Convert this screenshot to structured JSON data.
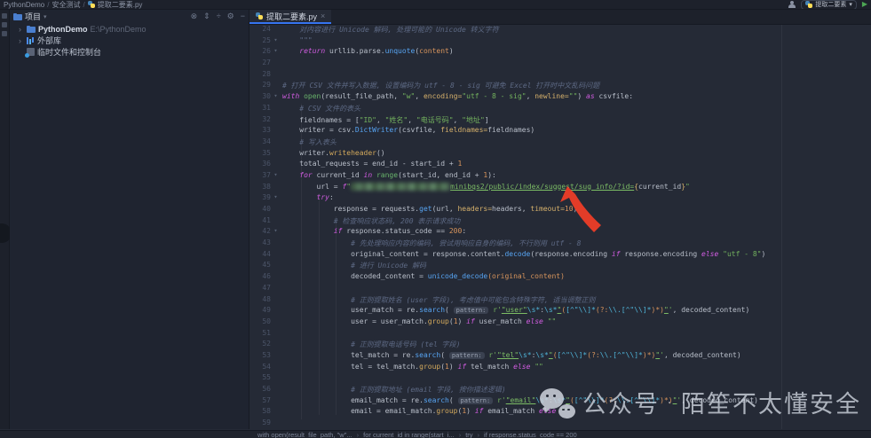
{
  "window": {
    "breadcrumb": [
      "PythonDemo",
      "安全测试",
      "提取二要素.py"
    ],
    "breadcrumb_separator": "/",
    "run_config": "提取二要素",
    "run_caret": "▾",
    "play_glyph": "▶"
  },
  "project_panel": {
    "title": "项目",
    "title_caret": "▾",
    "toolbar_icons": [
      {
        "name": "locate-file-icon",
        "glyph": "⊗"
      },
      {
        "name": "collapse-all-icon",
        "glyph": "⇕"
      },
      {
        "name": "split-view-icon",
        "glyph": "÷"
      },
      {
        "name": "settings-gear-icon",
        "glyph": "⚙"
      },
      {
        "name": "hide-panel-icon",
        "glyph": "−"
      }
    ],
    "tree": [
      {
        "label": "PythonDemo",
        "detail": "E:\\PythonDemo",
        "icon": "folder",
        "chevron": "›"
      },
      {
        "label": "外部库",
        "detail": "",
        "icon": "library",
        "chevron": "›"
      },
      {
        "label": "临时文件和控制台",
        "detail": "",
        "icon": "scratch",
        "chevron": ""
      }
    ]
  },
  "editor": {
    "tab": {
      "title": "提取二要素.py",
      "close_glyph": "×"
    },
    "fold_glyph": "▾",
    "lines": [
      {
        "n": 24,
        "t": [
          [
            "d",
            "    对内容进行 Unicode 解码, 处理可能的 Unicode 转义字符"
          ]
        ]
      },
      {
        "n": 25,
        "fold": true,
        "t": [
          [
            "d",
            "    \"\"\""
          ]
        ]
      },
      {
        "n": 26,
        "fold": true,
        "t": [
          [
            "t",
            "    "
          ],
          [
            "k",
            "return"
          ],
          [
            "t",
            " urllib.parse."
          ],
          [
            "f",
            "unquote"
          ],
          [
            "t",
            "("
          ],
          [
            "p",
            "content"
          ],
          [
            "t",
            ")"
          ]
        ]
      },
      {
        "n": 27,
        "t": []
      },
      {
        "n": 28,
        "t": []
      },
      {
        "n": 29,
        "t": [
          [
            "c",
            "# 打开 CSV 文件并写入数据, 设置编码为 utf - 8 - sig 可避免 Excel 打开时中文乱码问题"
          ]
        ]
      },
      {
        "n": 30,
        "fold": true,
        "t": [
          [
            "k",
            "with"
          ],
          [
            "t",
            " "
          ],
          [
            "b",
            "open"
          ],
          [
            "t",
            "(result_file_path, "
          ],
          [
            "s",
            "\"w\""
          ],
          [
            "t",
            ", "
          ],
          [
            "a",
            "encoding="
          ],
          [
            "s",
            "\"utf - 8 - sig\""
          ],
          [
            "t",
            ", "
          ],
          [
            "a",
            "newline="
          ],
          [
            "s",
            "\"\""
          ],
          [
            "t",
            ") "
          ],
          [
            "k",
            "as"
          ],
          [
            "t",
            " csvfile:"
          ]
        ]
      },
      {
        "n": 31,
        "t": [
          [
            "c",
            "    # CSV 文件的表头"
          ]
        ]
      },
      {
        "n": 32,
        "t": [
          [
            "t",
            "    fieldnames = ["
          ],
          [
            "s",
            "\"ID\""
          ],
          [
            "t",
            ", "
          ],
          [
            "s",
            "\"姓名\""
          ],
          [
            "t",
            ", "
          ],
          [
            "s",
            "\"电话号码\""
          ],
          [
            "t",
            ", "
          ],
          [
            "s",
            "\"地址\""
          ],
          [
            "t",
            "]"
          ]
        ]
      },
      {
        "n": 33,
        "t": [
          [
            "t",
            "    writer = csv."
          ],
          [
            "f",
            "DictWriter"
          ],
          [
            "t",
            "(csvfile, "
          ],
          [
            "a",
            "fieldnames="
          ],
          [
            "t",
            "fieldnames)"
          ]
        ]
      },
      {
        "n": 34,
        "t": [
          [
            "c",
            "    # 写入表头"
          ]
        ]
      },
      {
        "n": 35,
        "t": [
          [
            "t",
            "    writer."
          ],
          [
            "g",
            "writeheader"
          ],
          [
            "t",
            "()"
          ]
        ]
      },
      {
        "n": 36,
        "t": [
          [
            "t",
            "    total_requests = end_id - start_id + "
          ],
          [
            "n",
            "1"
          ]
        ]
      },
      {
        "n": 37,
        "fold": true,
        "t": [
          [
            "t",
            "    "
          ],
          [
            "k",
            "for"
          ],
          [
            "t",
            " current_id "
          ],
          [
            "k",
            "in"
          ],
          [
            "t",
            " "
          ],
          [
            "b",
            "range"
          ],
          [
            "t",
            "(start_id, end_id + "
          ],
          [
            "n",
            "1"
          ],
          [
            "t",
            "):"
          ]
        ]
      },
      {
        "n": 38,
        "t": [
          [
            "t",
            "        url = "
          ],
          [
            "k",
            "f"
          ],
          [
            "s",
            "\""
          ],
          [
            "blur",
            ""
          ],
          [
            "u",
            "minibqs2/public/index/suggest/sug_info/?id="
          ],
          [
            "fb",
            "{"
          ],
          [
            "t",
            "current_id"
          ],
          [
            "fb",
            "}"
          ],
          [
            "s",
            "\""
          ]
        ]
      },
      {
        "n": 39,
        "fold": true,
        "t": [
          [
            "t",
            "        "
          ],
          [
            "k",
            "try"
          ],
          [
            "t",
            ":"
          ]
        ]
      },
      {
        "n": 40,
        "t": [
          [
            "t",
            "            response = requests."
          ],
          [
            "f",
            "get"
          ],
          [
            "t",
            "(url, "
          ],
          [
            "a",
            "headers="
          ],
          [
            "t",
            "headers, "
          ],
          [
            "a",
            "timeout="
          ],
          [
            "n",
            "10"
          ],
          [
            "t",
            ")"
          ]
        ]
      },
      {
        "n": 41,
        "t": [
          [
            "c",
            "            # 检查响应状态码, 200 表示请求成功"
          ]
        ]
      },
      {
        "n": 42,
        "fold": true,
        "t": [
          [
            "t",
            "            "
          ],
          [
            "k",
            "if"
          ],
          [
            "t",
            " response.status_code == "
          ],
          [
            "n",
            "200"
          ],
          [
            "t",
            ":"
          ]
        ]
      },
      {
        "n": 43,
        "t": [
          [
            "c",
            "                # 先处理响应内容的编码, 尝试用响应自身的编码, 不行则用 utf - 8"
          ]
        ]
      },
      {
        "n": 44,
        "t": [
          [
            "t",
            "                original_content = response.content."
          ],
          [
            "f",
            "decode"
          ],
          [
            "t",
            "(response.encoding "
          ],
          [
            "k",
            "if"
          ],
          [
            "t",
            " response.encoding "
          ],
          [
            "k",
            "else"
          ],
          [
            "t",
            " "
          ],
          [
            "s",
            "\"utf - 8\""
          ],
          [
            "t",
            ")"
          ]
        ]
      },
      {
        "n": 45,
        "t": [
          [
            "c",
            "                # 进行 Unicode 解码"
          ]
        ]
      },
      {
        "n": 46,
        "t": [
          [
            "t",
            "                decoded_content = "
          ],
          [
            "f",
            "unicode_decode"
          ],
          [
            "p",
            "(original_content)"
          ]
        ]
      },
      {
        "n": 47,
        "t": []
      },
      {
        "n": 48,
        "t": [
          [
            "c",
            "                # 正则提取姓名 (user 字段), 考虑值中可能包含特殊字符, 适当调整正则"
          ]
        ]
      },
      {
        "n": 49,
        "t": [
          [
            "t",
            "                user_match = re."
          ],
          [
            "f",
            "search"
          ],
          [
            "t",
            "( "
          ],
          [
            "badge",
            "pattern:"
          ],
          [
            "t",
            " "
          ],
          [
            "s",
            "r'"
          ],
          [
            "u",
            "\"user\""
          ],
          [
            "rx",
            "\\s*"
          ],
          [
            "t",
            ":"
          ],
          [
            "rx",
            "\\s*"
          ],
          [
            "u",
            "\""
          ],
          [
            "ro",
            "("
          ],
          [
            "rx",
            "[^\"\\\\]*"
          ],
          [
            "ro",
            "(?:"
          ],
          [
            "rx",
            "\\\\."
          ],
          [
            "rx",
            "[^\"\\\\]*"
          ],
          [
            "ro",
            ")*)"
          ],
          [
            "u",
            "\""
          ],
          [
            "s",
            "'"
          ],
          [
            "t",
            ", decoded_content)"
          ]
        ]
      },
      {
        "n": 50,
        "t": [
          [
            "t",
            "                user = user_match."
          ],
          [
            "g",
            "group"
          ],
          [
            "t",
            "("
          ],
          [
            "n",
            "1"
          ],
          [
            "t",
            ") "
          ],
          [
            "k",
            "if"
          ],
          [
            "t",
            " user_match "
          ],
          [
            "k",
            "else"
          ],
          [
            "t",
            " "
          ],
          [
            "s",
            "\"\""
          ]
        ]
      },
      {
        "n": 51,
        "t": []
      },
      {
        "n": 52,
        "t": [
          [
            "c",
            "                # 正则提取电话号码 (tel 字段)"
          ]
        ]
      },
      {
        "n": 53,
        "t": [
          [
            "t",
            "                tel_match = re."
          ],
          [
            "f",
            "search"
          ],
          [
            "t",
            "( "
          ],
          [
            "badge",
            "pattern:"
          ],
          [
            "t",
            " "
          ],
          [
            "s",
            "r'"
          ],
          [
            "u",
            "\"tel\""
          ],
          [
            "rx",
            "\\s*"
          ],
          [
            "t",
            ":"
          ],
          [
            "rx",
            "\\s*"
          ],
          [
            "u",
            "\""
          ],
          [
            "ro",
            "("
          ],
          [
            "rx",
            "[^\"\\\\]*"
          ],
          [
            "ro",
            "(?:"
          ],
          [
            "rx",
            "\\\\."
          ],
          [
            "rx",
            "[^\"\\\\]*"
          ],
          [
            "ro",
            ")*)"
          ],
          [
            "u",
            "\""
          ],
          [
            "s",
            "'"
          ],
          [
            "t",
            ", decoded_content)"
          ]
        ]
      },
      {
        "n": 54,
        "t": [
          [
            "t",
            "                tel = tel_match."
          ],
          [
            "g",
            "group"
          ],
          [
            "t",
            "("
          ],
          [
            "n",
            "1"
          ],
          [
            "t",
            ") "
          ],
          [
            "k",
            "if"
          ],
          [
            "t",
            " tel_match "
          ],
          [
            "k",
            "else"
          ],
          [
            "t",
            " "
          ],
          [
            "s",
            "\"\""
          ]
        ]
      },
      {
        "n": 55,
        "t": []
      },
      {
        "n": 56,
        "t": [
          [
            "c",
            "                # 正则提取地址 (email 字段, 按你描述逻辑)"
          ]
        ]
      },
      {
        "n": 57,
        "t": [
          [
            "t",
            "                email_match = re."
          ],
          [
            "f",
            "search"
          ],
          [
            "t",
            "( "
          ],
          [
            "badge",
            "pattern:"
          ],
          [
            "t",
            " "
          ],
          [
            "s",
            "r'"
          ],
          [
            "u",
            "\"email\""
          ],
          [
            "rx",
            "\\s*"
          ],
          [
            "t",
            ":"
          ],
          [
            "rx",
            "\\s*"
          ],
          [
            "u",
            "\""
          ],
          [
            "ro",
            "("
          ],
          [
            "rx",
            "[^\"\\\\]*"
          ],
          [
            "ro",
            "(?:"
          ],
          [
            "rx",
            "\\\\."
          ],
          [
            "rx",
            "[^\"\\\\]*"
          ],
          [
            "ro",
            ")*)"
          ],
          [
            "u",
            "\""
          ],
          [
            "s",
            "'"
          ],
          [
            "t",
            ", decoded_content)"
          ]
        ]
      },
      {
        "n": 58,
        "t": [
          [
            "t",
            "                email = email_match."
          ],
          [
            "g",
            "group"
          ],
          [
            "t",
            "("
          ],
          [
            "n",
            "1"
          ],
          [
            "t",
            ") "
          ],
          [
            "k",
            "if"
          ],
          [
            "t",
            " email_match "
          ],
          [
            "k",
            "else"
          ],
          [
            "t",
            " "
          ],
          [
            "s",
            "\"\""
          ]
        ]
      },
      {
        "n": 59,
        "t": []
      }
    ]
  },
  "status_bar": {
    "separator": "›",
    "breadcrumbs": [
      "with open(result_file_path, \"w\"...",
      "for current_id in range(start_i...",
      "try",
      "if response.status_code == 200"
    ]
  },
  "watermark": {
    "prefix": "公众号",
    "separator": "·",
    "name": "陌笙不太懂安全"
  },
  "colors": {
    "accent_blue": "#3674f0",
    "run_green": "#4ca654",
    "arrow_red": "#e23c28",
    "editor_bg": "#252a36",
    "panel_bg": "#1f2430"
  }
}
